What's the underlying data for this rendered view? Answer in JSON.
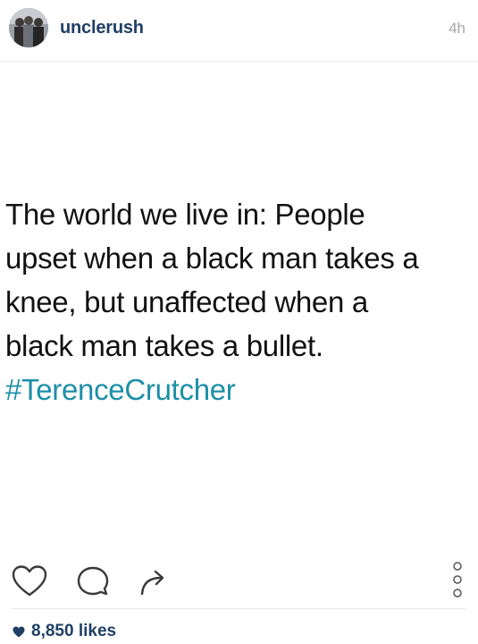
{
  "header": {
    "username": "unclerush",
    "timestamp": "4h",
    "avatar_icon": "avatar-photo"
  },
  "post": {
    "lines": [
      "The world we live in: People",
      "upset when a black man takes a",
      "knee, but unaffected when a",
      "black man takes a bullet."
    ],
    "hashtag": "#TerenceCrutcher"
  },
  "actions": {
    "like_icon": "heart-outline-icon",
    "comment_icon": "comment-bubble-icon",
    "share_icon": "share-arrow-icon",
    "more_icon": "vertical-dots-icon"
  },
  "likes": {
    "icon": "heart-filled-icon",
    "text": "8,850 likes"
  },
  "colors": {
    "username": "#1f3f66",
    "hashtag": "#1d8fa8",
    "timestamp": "#a6a6a6"
  }
}
